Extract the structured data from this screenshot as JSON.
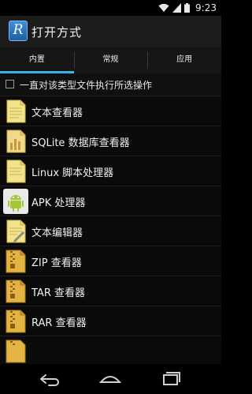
{
  "status": {
    "time": "9:23"
  },
  "header": {
    "title": "打开方式"
  },
  "tabs": [
    "内置",
    "常规",
    "应用"
  ],
  "checkbox": {
    "label": "一直对该类型文件执行所选操作"
  },
  "items": [
    {
      "label": "文本查看器",
      "icon": "text-file-icon"
    },
    {
      "label": "SQLite 数据库查看器",
      "icon": "database-file-icon"
    },
    {
      "label": "Linux 脚本处理器",
      "icon": "script-file-icon"
    },
    {
      "label": "APK 处理器",
      "icon": "android-icon"
    },
    {
      "label": "文本编辑器",
      "icon": "edit-file-icon"
    },
    {
      "label": "ZIP 查看器",
      "icon": "zip-archive-icon"
    },
    {
      "label": "TAR 查看器",
      "icon": "tar-archive-icon"
    },
    {
      "label": "RAR 查看器",
      "icon": "rar-archive-icon"
    }
  ],
  "colors": {
    "accent": "#33b5e5",
    "file_yellow": "#f3e38a",
    "archive_gold": "#d9a531",
    "android_green": "#a4c639"
  }
}
